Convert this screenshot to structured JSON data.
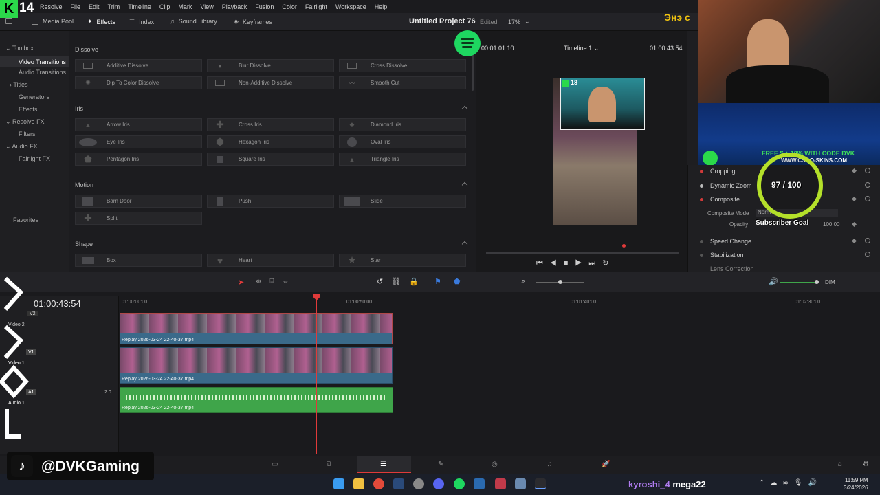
{
  "menu": [
    "Resolve",
    "File",
    "Edit",
    "Trim",
    "Timeline",
    "Clip",
    "Mark",
    "View",
    "Playback",
    "Fusion",
    "Color",
    "Fairlight",
    "Workspace",
    "Help"
  ],
  "toolbar": {
    "media_pool": "Media Pool",
    "effects": "Effects",
    "index": "Index",
    "sound_library": "Sound Library",
    "keyframes": "Keyframes"
  },
  "project": {
    "title": "Untitled Project 76",
    "status": "Edited"
  },
  "viewer": {
    "zoom": "17%",
    "source_tc": "00:01:01:10",
    "timeline_name": "Timeline 1",
    "tc": "01:00:43:54"
  },
  "left_panel": {
    "toolbox": "Toolbox",
    "video_transitions": "Video Transitions",
    "audio_transitions": "Audio Transitions",
    "titles": "Titles",
    "generators": "Generators",
    "effects": "Effects",
    "resolve_fx": "Resolve FX",
    "filters": "Filters",
    "audio_fx": "Audio FX",
    "fairlight_fx": "Fairlight FX",
    "favorites": "Favorites"
  },
  "effects": {
    "dissolve": {
      "title": "Dissolve",
      "items": [
        "Additive Dissolve",
        "Blur Dissolve",
        "Cross Dissolve",
        "Dip To Color Dissolve",
        "Non-Additive Dissolve",
        "Smooth Cut"
      ]
    },
    "iris": {
      "title": "Iris",
      "items": [
        "Arrow Iris",
        "Cross Iris",
        "Diamond Iris",
        "Eye Iris",
        "Hexagon Iris",
        "Oval Iris",
        "Pentagon Iris",
        "Square Iris",
        "Triangle Iris"
      ]
    },
    "motion": {
      "title": "Motion",
      "items": [
        "Barn Door",
        "Push",
        "Slide",
        "Split"
      ]
    },
    "shape": {
      "title": "Shape",
      "items": [
        "Box",
        "Heart",
        "Star"
      ]
    }
  },
  "inspector": {
    "cropping": "Cropping",
    "dynamic_zoom": "Dynamic Zoom",
    "composite": "Composite",
    "composite_mode_label": "Composite Mode",
    "composite_mode_value": "Norm",
    "opacity_label": "Opacity",
    "opacity_value": "100.00",
    "speed_change": "Speed Change",
    "stabilization": "Stabilization",
    "lens_correction": "Lens Correction"
  },
  "overlay": {
    "brand_num": "14",
    "inset_num": "18",
    "mongol_text": "Энэ с",
    "ad_text": "FREE $  + 10% WITH CODE DVK",
    "ad_url": "WWW.CSGO-SKINS.COM",
    "sub_count": "97 / 100",
    "sub_goal": "Subscriber Goal",
    "handle": "@DVKGaming",
    "chat_user": "kyroshi_4",
    "chat_msg": "mega22"
  },
  "timeline": {
    "timecode": "01:00:43:54",
    "ruler": [
      "01:00:00:00",
      "01:00:50:00",
      "01:01:40:00",
      "01:02:30:00"
    ],
    "tracks": {
      "v2": "V2",
      "v2_name": "Video 2",
      "v1": "V1",
      "v1_name": "Video 1",
      "a1": "A1",
      "a1_name": "Audio 1",
      "a1_level": "2.0"
    },
    "clip_name": "Replay 2026-03-24 22-40-37.mp4"
  },
  "audio_label": "DIM",
  "clock": {
    "time": "11:59 PM",
    "date": "3/24/2026"
  },
  "colors": {
    "accent": "#e03a3a",
    "audio_clip": "#3fa54a",
    "video_clip": "#3a6a8a",
    "spotify": "#1ed760",
    "sub_ring": "#b4e02a"
  }
}
